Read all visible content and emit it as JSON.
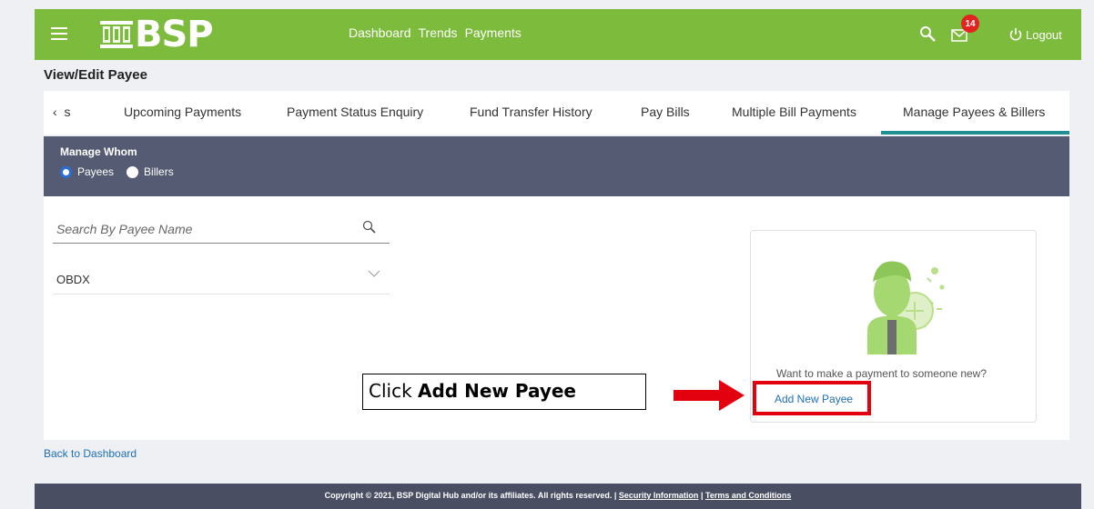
{
  "header": {
    "logo_text": "BSP",
    "nav": [
      "Dashboard",
      "Trends",
      "Payments"
    ],
    "notification_count": "14",
    "logout_label": "Logout",
    "brand_color": "#7dbb3c"
  },
  "page": {
    "title": "View/Edit Payee"
  },
  "tabs": {
    "scroll_prev_label": "s",
    "items": [
      "Upcoming Payments",
      "Payment Status Enquiry",
      "Fund Transfer History",
      "Pay Bills",
      "Multiple Bill Payments",
      "Manage Payees & Billers"
    ],
    "active": "Manage Payees & Billers",
    "active_color": "#1f8f92"
  },
  "manage_whom": {
    "title": "Manage Whom",
    "options": [
      "Payees",
      "Billers"
    ],
    "selected": "Payees"
  },
  "search": {
    "placeholder": "Search By Payee Name"
  },
  "payees": [
    "OBDX"
  ],
  "card": {
    "prompt": "Want to make a payment to someone new?",
    "add_label": "Add New Payee"
  },
  "callout": {
    "prefix": "Click ",
    "bold": "Add New Payee"
  },
  "back_link": "Back to Dashboard",
  "footer": {
    "copyright": "Copyright © 2021, BSP Digital Hub and/or its affiliates. All rights reserved. |",
    "security": "Security Information",
    "separator": "|",
    "terms": "Terms and Conditions"
  }
}
